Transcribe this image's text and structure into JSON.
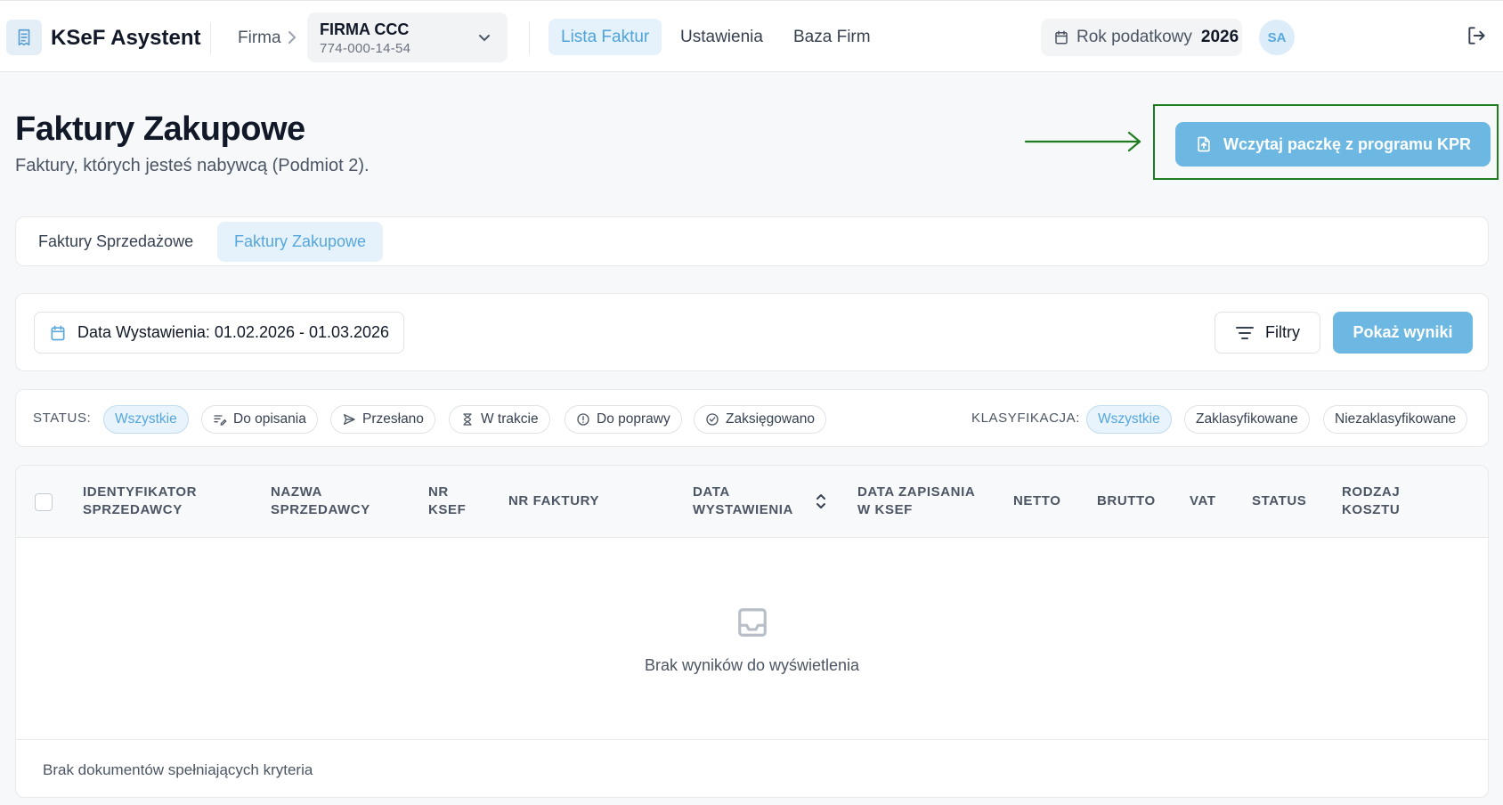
{
  "header": {
    "app_title": "KSeF Asystent",
    "firma_label": "Firma",
    "company": {
      "name": "FIRMA CCC",
      "nip": "774-000-14-54"
    },
    "nav": [
      {
        "label": "Lista Faktur",
        "active": true
      },
      {
        "label": "Ustawienia",
        "active": false
      },
      {
        "label": "Baza Firm",
        "active": false
      }
    ],
    "tax_year_label": "Rok podatkowy",
    "tax_year": "2026",
    "avatar_initials": "SA",
    "icons": [
      "receipt-icon",
      "chevron-right-icon",
      "chevron-down-icon",
      "calendar-icon",
      "logout-icon"
    ]
  },
  "page": {
    "title": "Faktury Zakupowe",
    "subtitle": "Faktury, których jesteś nabywcą (Podmiot 2).",
    "import_button": "Wczytaj paczkę z programu KPR"
  },
  "tabs": [
    {
      "label": "Faktury Sprzedażowe",
      "active": false
    },
    {
      "label": "Faktury Zakupowe",
      "active": true
    }
  ],
  "filters": {
    "date_range": "Data Wystawienia: 01.02.2026 - 01.03.2026",
    "filters_button": "Filtry",
    "show_results_button": "Pokaż wyniki"
  },
  "status": {
    "label": "STATUS:",
    "chips": [
      {
        "label": "Wszystkie",
        "active": true,
        "icon": ""
      },
      {
        "label": "Do opisania",
        "active": false,
        "icon": "edit-list-icon"
      },
      {
        "label": "Przesłano",
        "active": false,
        "icon": "send-icon"
      },
      {
        "label": "W trakcie",
        "active": false,
        "icon": "hourglass-icon"
      },
      {
        "label": "Do poprawy",
        "active": false,
        "icon": "alert-circle-icon"
      },
      {
        "label": "Zaksięgowano",
        "active": false,
        "icon": "check-circle-icon"
      }
    ]
  },
  "classification": {
    "label": "KLASYFIKACJA:",
    "chips": [
      {
        "label": "Wszystkie",
        "active": true
      },
      {
        "label": "Zaklasyfikowane",
        "active": false
      },
      {
        "label": "Niezaklasyfikowane",
        "active": false
      }
    ]
  },
  "table": {
    "columns": [
      [
        "IDENTYFIKATOR",
        "SPRZEDAWCY"
      ],
      [
        "NAZWA",
        "SPRZEDAWCY"
      ],
      [
        "NR",
        "KSEF"
      ],
      [
        "NR FAKTURY"
      ],
      [
        "DATA",
        "WYSTAWIENIA"
      ],
      [
        "DATA ZAPISANIA",
        "W KSEF"
      ],
      [
        "NETTO"
      ],
      [
        "BRUTTO"
      ],
      [
        "VAT"
      ],
      [
        "STATUS"
      ],
      [
        "RODZAJ",
        "KOSZTU"
      ]
    ],
    "empty_message": "Brak wyników do wyświetlenia",
    "footer_message": "Brak dokumentów spełniających kryteria"
  },
  "colors": {
    "accent": "#6cb8e3",
    "accent_text": "#55a7dc",
    "accent_bg": "#e6f2fb",
    "highlight_box": "#1e7d1e",
    "background": "#f7f8fa"
  }
}
